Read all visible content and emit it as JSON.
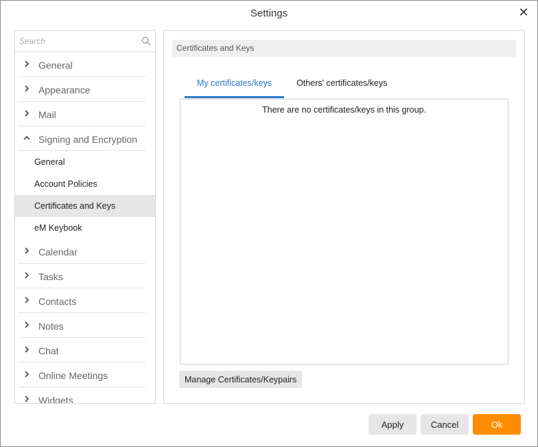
{
  "window": {
    "title": "Settings"
  },
  "search": {
    "placeholder": "Search"
  },
  "sidebar": {
    "sections_top": [
      {
        "label": "General"
      },
      {
        "label": "Appearance"
      },
      {
        "label": "Mail"
      }
    ],
    "expanded_section": {
      "label": "Signing and Encryption",
      "items": [
        {
          "label": "General"
        },
        {
          "label": "Account Policies"
        },
        {
          "label": "Certificates and Keys",
          "active": true
        },
        {
          "label": "eM Keybook"
        }
      ]
    },
    "sections_bottom": [
      {
        "label": "Calendar"
      },
      {
        "label": "Tasks"
      },
      {
        "label": "Contacts"
      },
      {
        "label": "Notes"
      },
      {
        "label": "Chat"
      },
      {
        "label": "Online Meetings"
      },
      {
        "label": "Widgets"
      }
    ]
  },
  "main": {
    "header": "Certificates and Keys",
    "tabs": [
      {
        "label": "My certificates/keys",
        "active": true
      },
      {
        "label": "Others' certificates/keys"
      }
    ],
    "empty_message": "There are no certificates/keys in this group.",
    "manage_button": "Manage Certificates/Keypairs"
  },
  "footer": {
    "apply": "Apply",
    "cancel": "Cancel",
    "ok": "Ok"
  },
  "colors": {
    "accent": "#2a7ac9",
    "ok_button": "#ff8c00",
    "active_item_bg": "#e6e6e6"
  }
}
